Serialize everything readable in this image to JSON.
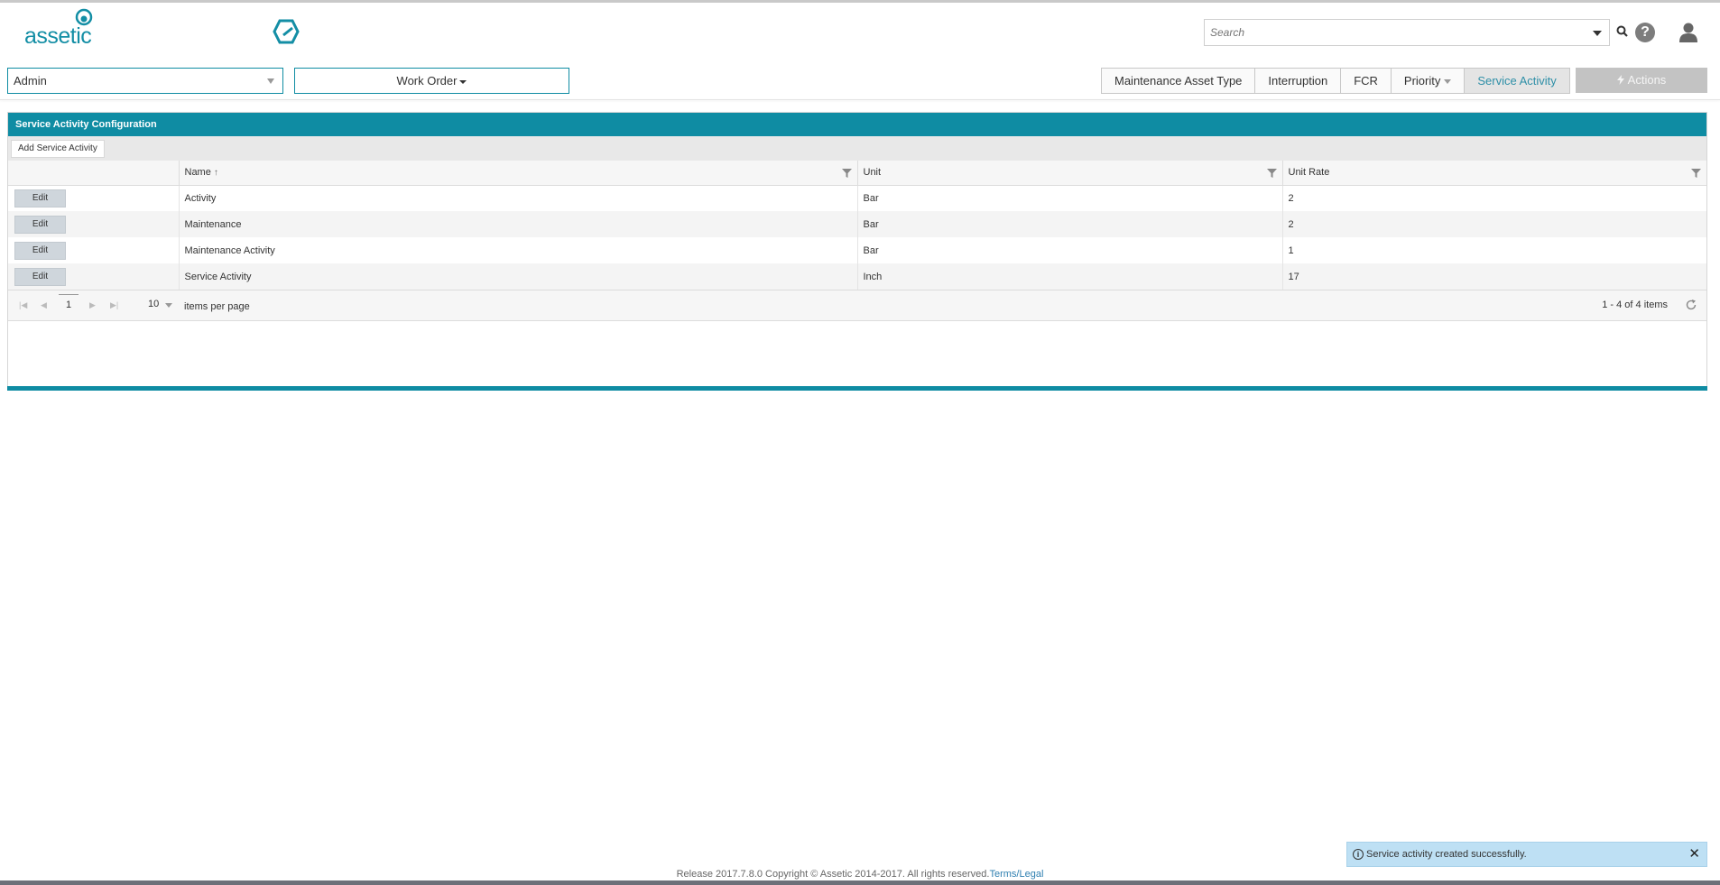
{
  "brand": {
    "name": "assetic",
    "color": "#138ea5"
  },
  "header": {
    "search_placeholder": "Search",
    "help_label": "?"
  },
  "toolbar": {
    "module_value": "Admin",
    "work_order_label": "Work Order",
    "tabs": [
      {
        "label": "Maintenance Asset Type",
        "active": false
      },
      {
        "label": "Interruption",
        "active": false
      },
      {
        "label": "FCR",
        "active": false
      },
      {
        "label": "Priority",
        "active": false
      },
      {
        "label": "Service Activity",
        "active": true
      }
    ],
    "actions_label": "Actions"
  },
  "panel": {
    "title": "Service Activity Configuration",
    "add_label": "Add Service Activity",
    "columns": [
      "Name",
      "Unit",
      "Unit Rate"
    ],
    "sort_indicator": "↑",
    "edit_label": "Edit",
    "rows": [
      {
        "name": "Activity",
        "unit": "Bar",
        "rate": "2"
      },
      {
        "name": "Maintenance",
        "unit": "Bar",
        "rate": "2"
      },
      {
        "name": "Maintenance Activity",
        "unit": "Bar",
        "rate": "1"
      },
      {
        "name": "Service Activity",
        "unit": "Inch",
        "rate": "17"
      }
    ],
    "pager": {
      "current_page": "1",
      "per_page": "10",
      "per_page_label": "items per page",
      "items_info": "1 - 4 of 4 items"
    }
  },
  "notification": {
    "message": "Service activity created successfully.",
    "close": "✕"
  },
  "footer": {
    "text": "Release 2017.7.8.0 Copyright © Assetic 2014-2017. All rights reserved.",
    "link": "Terms/Legal"
  }
}
